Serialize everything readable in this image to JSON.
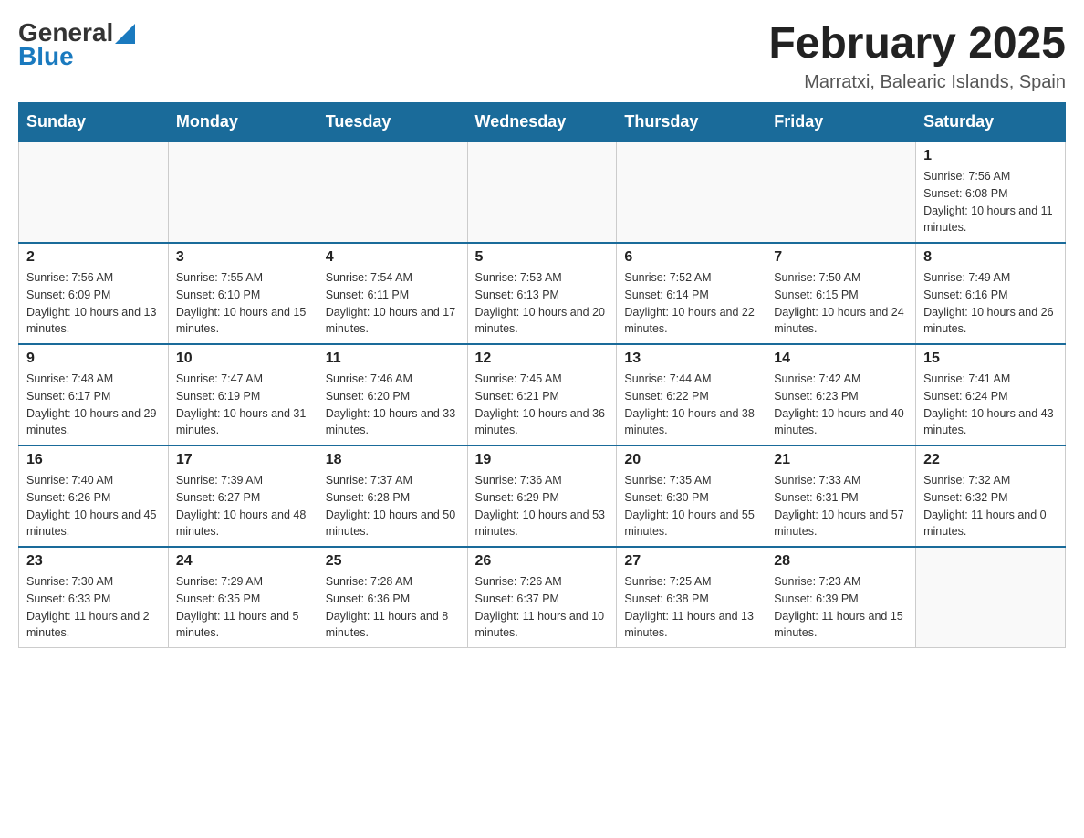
{
  "logo": {
    "general": "General",
    "blue": "Blue"
  },
  "title": "February 2025",
  "subtitle": "Marratxi, Balearic Islands, Spain",
  "days_of_week": [
    "Sunday",
    "Monday",
    "Tuesday",
    "Wednesday",
    "Thursday",
    "Friday",
    "Saturday"
  ],
  "weeks": [
    [
      {
        "day": "",
        "sunrise": "",
        "sunset": "",
        "daylight": ""
      },
      {
        "day": "",
        "sunrise": "",
        "sunset": "",
        "daylight": ""
      },
      {
        "day": "",
        "sunrise": "",
        "sunset": "",
        "daylight": ""
      },
      {
        "day": "",
        "sunrise": "",
        "sunset": "",
        "daylight": ""
      },
      {
        "day": "",
        "sunrise": "",
        "sunset": "",
        "daylight": ""
      },
      {
        "day": "",
        "sunrise": "",
        "sunset": "",
        "daylight": ""
      },
      {
        "day": "1",
        "sunrise": "Sunrise: 7:56 AM",
        "sunset": "Sunset: 6:08 PM",
        "daylight": "Daylight: 10 hours and 11 minutes."
      }
    ],
    [
      {
        "day": "2",
        "sunrise": "Sunrise: 7:56 AM",
        "sunset": "Sunset: 6:09 PM",
        "daylight": "Daylight: 10 hours and 13 minutes."
      },
      {
        "day": "3",
        "sunrise": "Sunrise: 7:55 AM",
        "sunset": "Sunset: 6:10 PM",
        "daylight": "Daylight: 10 hours and 15 minutes."
      },
      {
        "day": "4",
        "sunrise": "Sunrise: 7:54 AM",
        "sunset": "Sunset: 6:11 PM",
        "daylight": "Daylight: 10 hours and 17 minutes."
      },
      {
        "day": "5",
        "sunrise": "Sunrise: 7:53 AM",
        "sunset": "Sunset: 6:13 PM",
        "daylight": "Daylight: 10 hours and 20 minutes."
      },
      {
        "day": "6",
        "sunrise": "Sunrise: 7:52 AM",
        "sunset": "Sunset: 6:14 PM",
        "daylight": "Daylight: 10 hours and 22 minutes."
      },
      {
        "day": "7",
        "sunrise": "Sunrise: 7:50 AM",
        "sunset": "Sunset: 6:15 PM",
        "daylight": "Daylight: 10 hours and 24 minutes."
      },
      {
        "day": "8",
        "sunrise": "Sunrise: 7:49 AM",
        "sunset": "Sunset: 6:16 PM",
        "daylight": "Daylight: 10 hours and 26 minutes."
      }
    ],
    [
      {
        "day": "9",
        "sunrise": "Sunrise: 7:48 AM",
        "sunset": "Sunset: 6:17 PM",
        "daylight": "Daylight: 10 hours and 29 minutes."
      },
      {
        "day": "10",
        "sunrise": "Sunrise: 7:47 AM",
        "sunset": "Sunset: 6:19 PM",
        "daylight": "Daylight: 10 hours and 31 minutes."
      },
      {
        "day": "11",
        "sunrise": "Sunrise: 7:46 AM",
        "sunset": "Sunset: 6:20 PM",
        "daylight": "Daylight: 10 hours and 33 minutes."
      },
      {
        "day": "12",
        "sunrise": "Sunrise: 7:45 AM",
        "sunset": "Sunset: 6:21 PM",
        "daylight": "Daylight: 10 hours and 36 minutes."
      },
      {
        "day": "13",
        "sunrise": "Sunrise: 7:44 AM",
        "sunset": "Sunset: 6:22 PM",
        "daylight": "Daylight: 10 hours and 38 minutes."
      },
      {
        "day": "14",
        "sunrise": "Sunrise: 7:42 AM",
        "sunset": "Sunset: 6:23 PM",
        "daylight": "Daylight: 10 hours and 40 minutes."
      },
      {
        "day": "15",
        "sunrise": "Sunrise: 7:41 AM",
        "sunset": "Sunset: 6:24 PM",
        "daylight": "Daylight: 10 hours and 43 minutes."
      }
    ],
    [
      {
        "day": "16",
        "sunrise": "Sunrise: 7:40 AM",
        "sunset": "Sunset: 6:26 PM",
        "daylight": "Daylight: 10 hours and 45 minutes."
      },
      {
        "day": "17",
        "sunrise": "Sunrise: 7:39 AM",
        "sunset": "Sunset: 6:27 PM",
        "daylight": "Daylight: 10 hours and 48 minutes."
      },
      {
        "day": "18",
        "sunrise": "Sunrise: 7:37 AM",
        "sunset": "Sunset: 6:28 PM",
        "daylight": "Daylight: 10 hours and 50 minutes."
      },
      {
        "day": "19",
        "sunrise": "Sunrise: 7:36 AM",
        "sunset": "Sunset: 6:29 PM",
        "daylight": "Daylight: 10 hours and 53 minutes."
      },
      {
        "day": "20",
        "sunrise": "Sunrise: 7:35 AM",
        "sunset": "Sunset: 6:30 PM",
        "daylight": "Daylight: 10 hours and 55 minutes."
      },
      {
        "day": "21",
        "sunrise": "Sunrise: 7:33 AM",
        "sunset": "Sunset: 6:31 PM",
        "daylight": "Daylight: 10 hours and 57 minutes."
      },
      {
        "day": "22",
        "sunrise": "Sunrise: 7:32 AM",
        "sunset": "Sunset: 6:32 PM",
        "daylight": "Daylight: 11 hours and 0 minutes."
      }
    ],
    [
      {
        "day": "23",
        "sunrise": "Sunrise: 7:30 AM",
        "sunset": "Sunset: 6:33 PM",
        "daylight": "Daylight: 11 hours and 2 minutes."
      },
      {
        "day": "24",
        "sunrise": "Sunrise: 7:29 AM",
        "sunset": "Sunset: 6:35 PM",
        "daylight": "Daylight: 11 hours and 5 minutes."
      },
      {
        "day": "25",
        "sunrise": "Sunrise: 7:28 AM",
        "sunset": "Sunset: 6:36 PM",
        "daylight": "Daylight: 11 hours and 8 minutes."
      },
      {
        "day": "26",
        "sunrise": "Sunrise: 7:26 AM",
        "sunset": "Sunset: 6:37 PM",
        "daylight": "Daylight: 11 hours and 10 minutes."
      },
      {
        "day": "27",
        "sunrise": "Sunrise: 7:25 AM",
        "sunset": "Sunset: 6:38 PM",
        "daylight": "Daylight: 11 hours and 13 minutes."
      },
      {
        "day": "28",
        "sunrise": "Sunrise: 7:23 AM",
        "sunset": "Sunset: 6:39 PM",
        "daylight": "Daylight: 11 hours and 15 minutes."
      },
      {
        "day": "",
        "sunrise": "",
        "sunset": "",
        "daylight": ""
      }
    ]
  ]
}
